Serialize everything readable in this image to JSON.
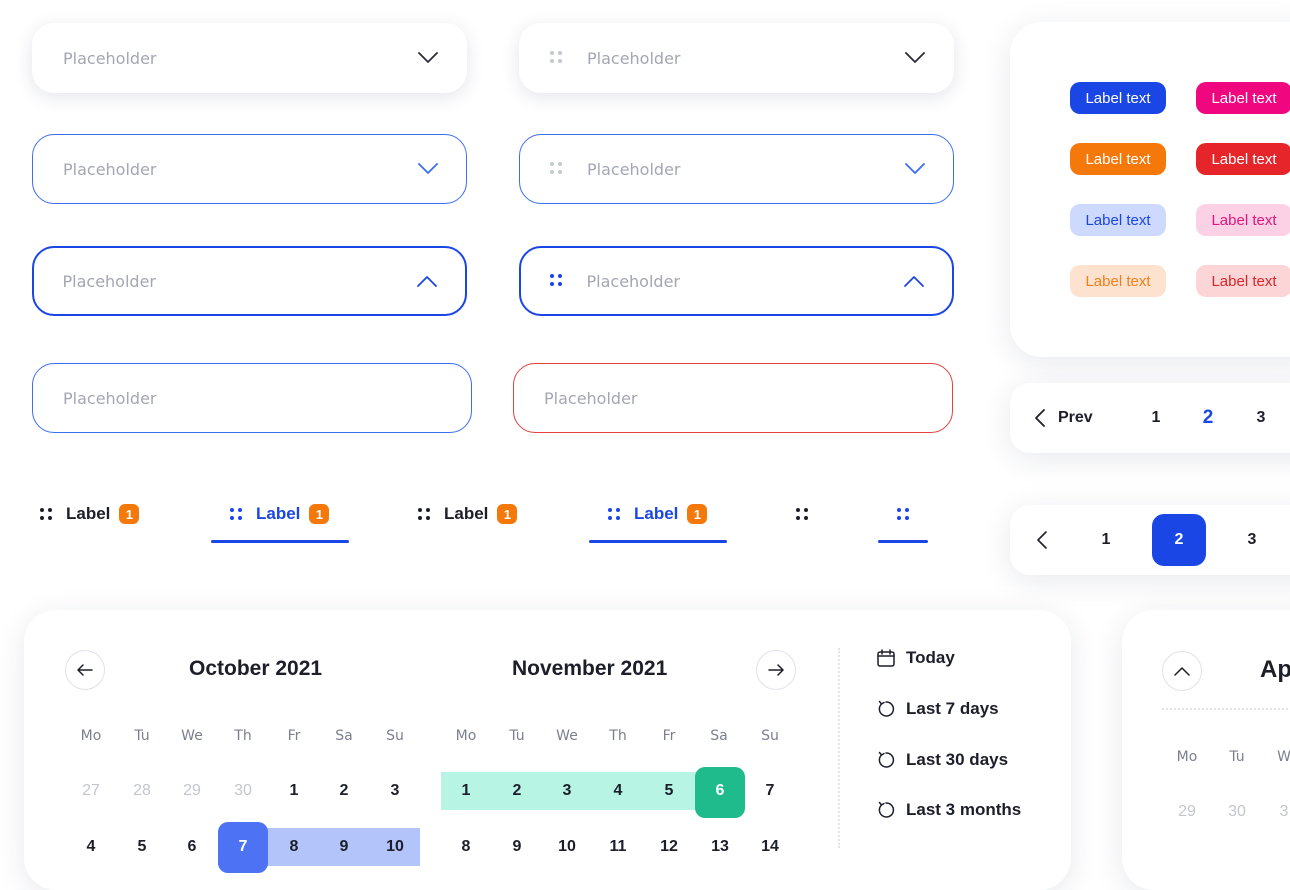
{
  "selects": {
    "placeholder": "Placeholder"
  },
  "inputs": {
    "placeholder": "Placeholder"
  },
  "labels": {
    "chips": [
      {
        "text": "Label text",
        "bg": "#1b46e6",
        "fg": "#ffffff"
      },
      {
        "text": "Label text",
        "bg": "#f0077f",
        "fg": "#ffffff"
      },
      {
        "text": "Label text",
        "bg": "#f5780a",
        "fg": "#ffffff"
      },
      {
        "text": "Label text",
        "bg": "#e5252a",
        "fg": "#ffffff"
      },
      {
        "text": "Label text",
        "bg": "#cdd9fd",
        "fg": "#1b46e6"
      },
      {
        "text": "Label text",
        "bg": "#fcd1e6",
        "fg": "#e0157b"
      },
      {
        "text": "Label text",
        "bg": "#fde2cf",
        "fg": "#f07f1a"
      },
      {
        "text": "Label text",
        "bg": "#fcd6d7",
        "fg": "#d8252a"
      }
    ]
  },
  "pagination_text": {
    "prev": "Prev",
    "pages": [
      "1",
      "2",
      "3"
    ],
    "current": "2"
  },
  "pagination_compact": {
    "pages": [
      "1",
      "2",
      "3"
    ],
    "current": "2"
  },
  "tabs": {
    "label": "Label",
    "badge": "1"
  },
  "calendar": {
    "months": [
      "October 2021",
      "November 2021"
    ],
    "weekdays": [
      "Mo",
      "Tu",
      "We",
      "Th",
      "Fr",
      "Sa",
      "Su"
    ],
    "october": {
      "row1": [
        "27",
        "28",
        "29",
        "30",
        "1",
        "2",
        "3"
      ],
      "row2": [
        "4",
        "5",
        "6",
        "7",
        "8",
        "9",
        "10"
      ]
    },
    "november": {
      "row1": [
        "1",
        "2",
        "3",
        "4",
        "5",
        "6",
        "7"
      ],
      "row2": [
        "8",
        "9",
        "10",
        "11",
        "12",
        "13",
        "14"
      ]
    },
    "presets": [
      "Today",
      "Last 7 days",
      "Last 30 days",
      "Last 3 months"
    ],
    "colors": {
      "green_range": "#b8f4e4",
      "green_selected": "#1fbb8c",
      "blue_range": "#b3c4fb",
      "blue_selected": "#4d73f4"
    }
  },
  "calendar2": {
    "title": "Ap",
    "weekdays": [
      "Mo",
      "Tu",
      "W"
    ],
    "row1": [
      "29",
      "30",
      "3"
    ]
  }
}
